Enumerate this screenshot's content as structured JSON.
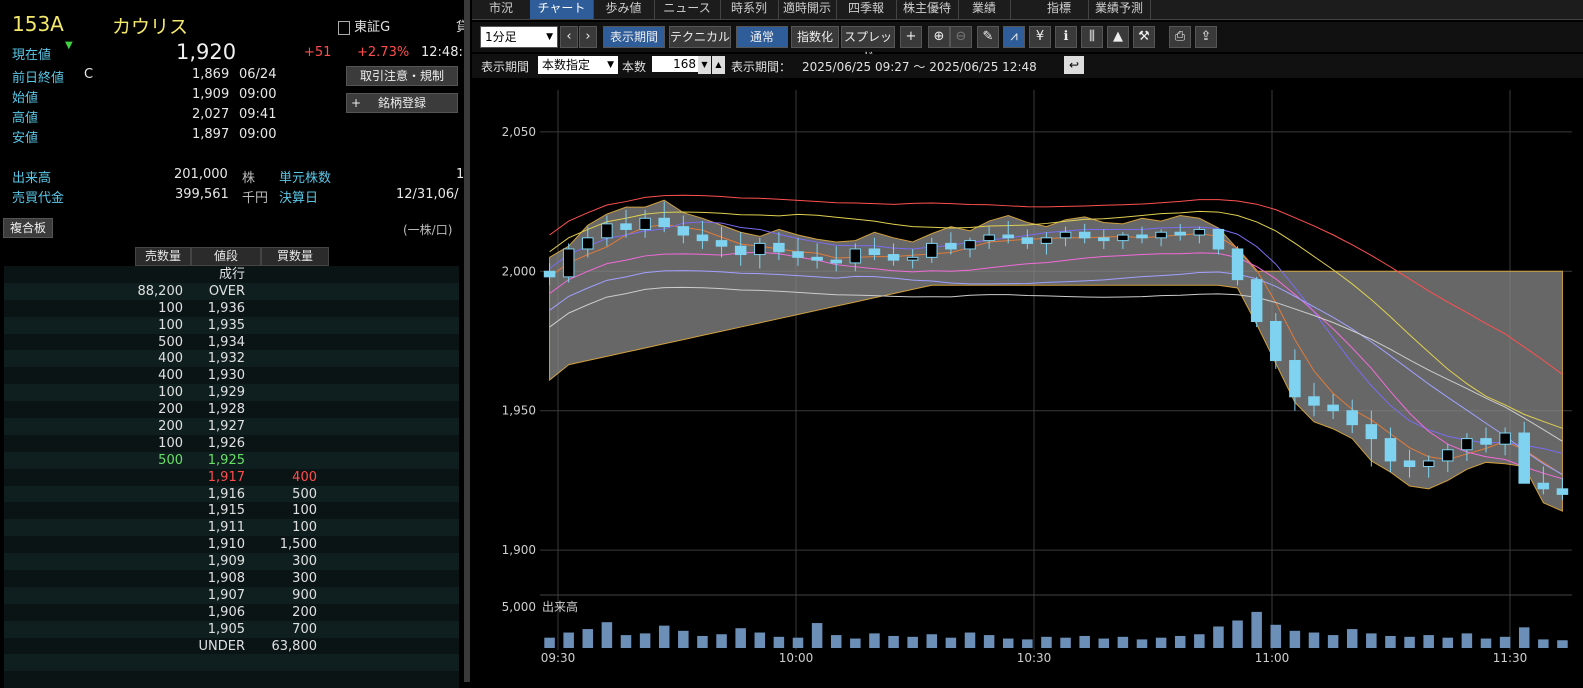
{
  "stock": {
    "code": "153A",
    "name": "カウリス",
    "market": "東証G",
    "market_cut": "貸",
    "price_label": "現在値",
    "price": "1,920",
    "change": "+51",
    "change_pct": "+2.73%",
    "time": "12:48:"
  },
  "details": [
    {
      "label": "前日終値",
      "mark": "C",
      "value": "1,869",
      "time": "06/24"
    },
    {
      "label": "始値",
      "mark": "",
      "value": "1,909",
      "time": "09:00"
    },
    {
      "label": "高値",
      "mark": "",
      "value": "2,027",
      "time": "09:41"
    },
    {
      "label": "安値",
      "mark": "",
      "value": "1,897",
      "time": "09:00"
    }
  ],
  "volume": {
    "label": "出来高",
    "value": "201,000",
    "unit": "株",
    "unit_label": "単元株数",
    "unit_value": "1",
    "amount_label": "売買代金",
    "amount": "399,561",
    "amount_unit": "千円",
    "settle_label": "決算日",
    "settle": "12/31,06/"
  },
  "buttons": {
    "notice": "取引注意・規制",
    "register": "銘柄登録",
    "register_icon": "plus-icon"
  },
  "board": {
    "title": "複合板",
    "unit_note": "(一株/口)",
    "headers": [
      "売数量",
      "値段",
      "買数量"
    ],
    "market_order": "成行",
    "rows": [
      {
        "sell": "88,200",
        "price": "OVER",
        "buy": ""
      },
      {
        "sell": "100",
        "price": "1,936",
        "buy": ""
      },
      {
        "sell": "100",
        "price": "1,935",
        "buy": ""
      },
      {
        "sell": "500",
        "price": "1,934",
        "buy": ""
      },
      {
        "sell": "400",
        "price": "1,932",
        "buy": ""
      },
      {
        "sell": "400",
        "price": "1,930",
        "buy": ""
      },
      {
        "sell": "100",
        "price": "1,929",
        "buy": ""
      },
      {
        "sell": "200",
        "price": "1,928",
        "buy": ""
      },
      {
        "sell": "200",
        "price": "1,927",
        "buy": ""
      },
      {
        "sell": "100",
        "price": "1,926",
        "buy": ""
      },
      {
        "sell": "500",
        "price": "1,925",
        "buy": "",
        "hl": "green"
      },
      {
        "sell": "",
        "price": "1,917",
        "buy": "400",
        "hl": "red"
      },
      {
        "sell": "",
        "price": "1,916",
        "buy": "500"
      },
      {
        "sell": "",
        "price": "1,915",
        "buy": "100"
      },
      {
        "sell": "",
        "price": "1,911",
        "buy": "100"
      },
      {
        "sell": "",
        "price": "1,910",
        "buy": "1,500"
      },
      {
        "sell": "",
        "price": "1,909",
        "buy": "300"
      },
      {
        "sell": "",
        "price": "1,908",
        "buy": "300"
      },
      {
        "sell": "",
        "price": "1,907",
        "buy": "900"
      },
      {
        "sell": "",
        "price": "1,906",
        "buy": "200"
      },
      {
        "sell": "",
        "price": "1,905",
        "buy": "700"
      },
      {
        "sell": "",
        "price": "UNDER",
        "buy": "63,800"
      }
    ]
  },
  "tabs": [
    "市況",
    "チャート",
    "歩み値",
    "ニュース",
    "時系列",
    "適時開示",
    "四季報",
    "株主優待",
    "業績",
    "指標",
    "業績予測"
  ],
  "active_tab": "チャート",
  "toolbar": {
    "interval": "1分足",
    "period_btn": "表示期間",
    "technical_btn": "テクニカル",
    "normal_btn": "通常",
    "index_btn": "指数化",
    "spread_btn": "スプレッド",
    "icons": [
      "plus-icon",
      "zoom-in-icon",
      "zoom-out-icon",
      "pencil-icon",
      "line-chart-icon",
      "yen-icon",
      "info-icon",
      "candle-icon",
      "area-icon",
      "wrench-icon",
      "print-icon",
      "export-icon"
    ]
  },
  "period": {
    "label": "表示期間",
    "mode": "本数指定",
    "count_label": "本数",
    "count": "168",
    "range_label": "表示期間：",
    "range": "2025/06/25 09:27 ～ 2025/06/25 12:48"
  },
  "chart_data": {
    "type": "candlestick",
    "y_ticks": [
      "2,050",
      "2,000",
      "1,950",
      "1,900"
    ],
    "ylim": [
      1885,
      2065
    ],
    "x_ticks": [
      "09:30",
      "10:00",
      "10:30",
      "11:00",
      "11:30"
    ],
    "volume_label": "出来高",
    "volume_tick": "5,000",
    "candles": [
      [
        2000,
        2003,
        1995,
        1998
      ],
      [
        1998,
        2010,
        1996,
        2008
      ],
      [
        2008,
        2016,
        2005,
        2012
      ],
      [
        2012,
        2020,
        2009,
        2017
      ],
      [
        2017,
        2022,
        2012,
        2015
      ],
      [
        2015,
        2022,
        2012,
        2019
      ],
      [
        2019,
        2025,
        2014,
        2016
      ],
      [
        2016,
        2020,
        2010,
        2013
      ],
      [
        2013,
        2018,
        2008,
        2011
      ],
      [
        2011,
        2016,
        2005,
        2009
      ],
      [
        2009,
        2014,
        2002,
        2006
      ],
      [
        2006,
        2012,
        2001,
        2010
      ],
      [
        2010,
        2014,
        2004,
        2007
      ],
      [
        2007,
        2012,
        2002,
        2005
      ],
      [
        2005,
        2010,
        2001,
        2004
      ],
      [
        2004,
        2009,
        2000,
        2003
      ],
      [
        2003,
        2010,
        2000,
        2008
      ],
      [
        2008,
        2012,
        2004,
        2006
      ],
      [
        2006,
        2010,
        2002,
        2004
      ],
      [
        2004,
        2008,
        2001,
        2005
      ],
      [
        2005,
        2012,
        2003,
        2010
      ],
      [
        2010,
        2014,
        2006,
        2008
      ],
      [
        2008,
        2012,
        2005,
        2011
      ],
      [
        2011,
        2016,
        2008,
        2013
      ],
      [
        2013,
        2018,
        2010,
        2012
      ],
      [
        2012,
        2015,
        2008,
        2010
      ],
      [
        2010,
        2014,
        2006,
        2012
      ],
      [
        2012,
        2016,
        2009,
        2014
      ],
      [
        2014,
        2017,
        2010,
        2012
      ],
      [
        2012,
        2015,
        2008,
        2011
      ],
      [
        2011,
        2014,
        2008,
        2013
      ],
      [
        2013,
        2016,
        2010,
        2012
      ],
      [
        2012,
        2015,
        2009,
        2014
      ],
      [
        2014,
        2017,
        2011,
        2013
      ],
      [
        2013,
        2016,
        2010,
        2015
      ],
      [
        2015,
        2013,
        2006,
        2008
      ],
      [
        2008,
        2009,
        1995,
        1997
      ],
      [
        1997,
        1998,
        1980,
        1982
      ],
      [
        1982,
        1985,
        1965,
        1968
      ],
      [
        1968,
        1972,
        1950,
        1955
      ],
      [
        1955,
        1960,
        1948,
        1952
      ],
      [
        1952,
        1956,
        1947,
        1950
      ],
      [
        1950,
        1954,
        1942,
        1945
      ],
      [
        1945,
        1950,
        1930,
        1940
      ],
      [
        1940,
        1944,
        1928,
        1932
      ],
      [
        1932,
        1936,
        1926,
        1930
      ],
      [
        1930,
        1934,
        1926,
        1932
      ],
      [
        1932,
        1938,
        1928,
        1936
      ],
      [
        1936,
        1942,
        1932,
        1940
      ],
      [
        1940,
        1944,
        1935,
        1938
      ],
      [
        1938,
        1944,
        1934,
        1942
      ],
      [
        1942,
        1946,
        1930,
        1924
      ],
      [
        1924,
        1930,
        1920,
        1922
      ],
      [
        1922,
        1926,
        1918,
        1920
      ]
    ],
    "volumes": [
      1200,
      1800,
      2200,
      3000,
      1500,
      1700,
      2600,
      2000,
      1400,
      1600,
      2300,
      1800,
      1300,
      1200,
      2900,
      1500,
      1100,
      1700,
      1400,
      1300,
      1600,
      1200,
      1800,
      1500,
      1100,
      1000,
      1300,
      1200,
      1400,
      1100,
      1300,
      1000,
      1200,
      1400,
      1600,
      2500,
      3200,
      4200,
      2700,
      2000,
      1800,
      1500,
      2200,
      1700,
      1400,
      1300,
      1500,
      1200,
      1700,
      1100,
      1300,
      2400,
      1000,
      900
    ]
  }
}
